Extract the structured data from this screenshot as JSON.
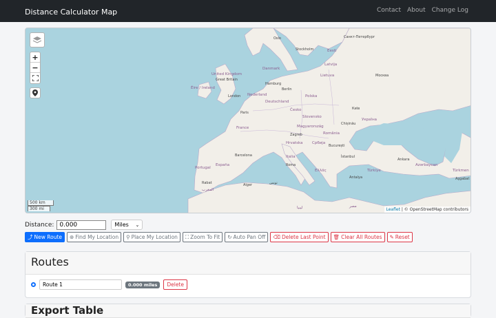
{
  "navbar": {
    "brand": "Distance Calculator Map",
    "links": [
      "Contact",
      "About",
      "Change Log"
    ]
  },
  "map": {
    "zoom_in": "+",
    "zoom_out": "−",
    "scale_km": "500 km",
    "scale_mi": "300 mi",
    "attribution_leaflet": "Leaflet",
    "attribution_rest": " | © OpenStreetMap contributors",
    "labels": {
      "oslo": "Oslo",
      "stockholm": "Stockholm",
      "spb": "Санкт-Петербург",
      "eesti": "Eesti",
      "latvija": "Latvija",
      "lietuva": "Lietuva",
      "moskva": "Москва",
      "danmark": "Danmark",
      "uk": "United Kingdom",
      "gb": "Great Britain",
      "eire": "Éire / Ireland",
      "london": "London",
      "hamburg": "Hamburg",
      "berlin": "Berlin",
      "nederland": "Nederland",
      "polska": "Polska",
      "deutschland": "Deutschland",
      "kyiv": "Київ",
      "ukraina": "Україна",
      "paris": "Paris",
      "cesko": "Česko",
      "slovensko": "Slovensko",
      "chisinau": "Chișinău",
      "france": "France",
      "magyar": "Magyarország",
      "romania": "România",
      "zagreb": "Zagreb",
      "srbija": "Србија",
      "bucuresti": "București",
      "hrvatska": "Hrvatska",
      "barcelona": "Barcelona",
      "italia": "Italia",
      "istanbul": "İstanbul",
      "portugal": "Portugal",
      "espana": "España",
      "roma": "Roma",
      "ellas": "Ελλάς",
      "turkiye": "Türkiye",
      "azerbaycan": "Azərbaycan",
      "turkmen": "Türkmen",
      "ankara": "Ankara",
      "antalya": "Antalya",
      "rabat": "Rabat",
      "alger": "Alger",
      "tunis": "تونس",
      "maroc": "المغرب",
      "ashgabat": "Aşgabat",
      "misr": "مصر",
      "libya": "ليبيا"
    }
  },
  "distance": {
    "label": "Distance:",
    "value": "0.000",
    "unit": "Miles"
  },
  "buttons": {
    "new_route": "New Route",
    "find_location": "Find My Location",
    "place_location": "Place My Location",
    "zoom_fit": "Zoom To Fit",
    "auto_pan": "Auto Pan Off",
    "delete_last": "Delete Last Point",
    "clear_all": "Clear All Routes",
    "reset": "Reset"
  },
  "routes": {
    "title": "Routes",
    "items": [
      {
        "name": "Route 1",
        "distance": "0.000 miles",
        "delete_label": "Delete"
      }
    ]
  },
  "export": {
    "title": "Export Table"
  },
  "colors": {
    "navbar": "#212529",
    "primary": "#0d6efd",
    "danger": "#dc3545",
    "secondary": "#6c757d",
    "sea": "#aad3df",
    "land": "#f2efe9"
  }
}
